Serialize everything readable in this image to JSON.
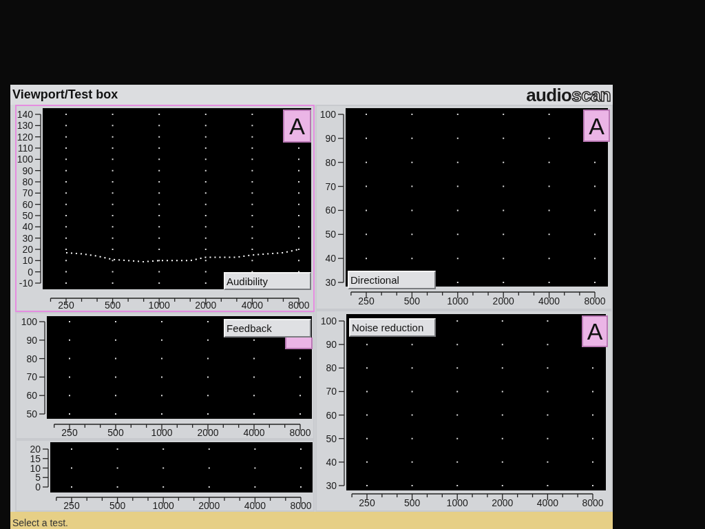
{
  "window": {
    "title": "Viewport/Test box",
    "logo": [
      "audio",
      "scan"
    ]
  },
  "panels": [
    {
      "selected": true,
      "badge": "A",
      "button": "Audibility",
      "chart_data": {
        "type": "line",
        "grid": true,
        "categories": [
          "250",
          null,
          null,
          "500",
          null,
          null,
          "1000",
          null,
          null,
          "2000",
          null,
          null,
          "4000",
          null,
          null,
          "8000"
        ],
        "ylim": [
          -10,
          140
        ],
        "yticks": [
          -10,
          0,
          10,
          20,
          30,
          40,
          50,
          60,
          70,
          80,
          90,
          100,
          110,
          120,
          130,
          140
        ],
        "series": [
          {
            "color": "#ffffff",
            "line_style": "dotted",
            "values": [
              17,
              16,
              14,
              11,
              10,
              9,
              10,
              10,
              10,
              13,
              13,
              13,
              15,
              16,
              17,
              20
            ]
          }
        ]
      }
    },
    {
      "selected": false,
      "badge": "A",
      "button": "Directional",
      "chart_data": {
        "type": "line",
        "grid": true,
        "categories": [
          "250",
          null,
          null,
          "500",
          null,
          null,
          "1000",
          null,
          null,
          "2000",
          null,
          null,
          "4000",
          null,
          null,
          "8000"
        ],
        "ylim": [
          30,
          100
        ],
        "yticks": [
          30,
          40,
          50,
          60,
          70,
          80,
          90,
          100
        ]
      }
    },
    {
      "selected": false,
      "badge_covered": true,
      "button": "Feedback",
      "chart_data": {
        "type": "line",
        "grid": true,
        "categories": [
          "250",
          null,
          null,
          "500",
          null,
          null,
          "1000",
          null,
          null,
          "2000",
          null,
          null,
          "4000",
          null,
          null,
          "8000"
        ],
        "ylim": [
          50,
          100
        ],
        "yticks": [
          50,
          60,
          70,
          80,
          90,
          100
        ]
      }
    },
    {
      "selected": false,
      "badge": "A",
      "button": "Noise reduction",
      "chart_data": {
        "type": "line",
        "grid": true,
        "categories": [
          "250",
          null,
          null,
          "500",
          null,
          null,
          "1000",
          null,
          null,
          "2000",
          null,
          null,
          "4000",
          null,
          null,
          "8000"
        ],
        "ylim": [
          30,
          100
        ],
        "yticks": [
          30,
          40,
          50,
          60,
          70,
          80,
          90,
          100
        ]
      }
    },
    {
      "selected": false,
      "chart_data": {
        "type": "line",
        "grid": true,
        "categories": [
          "250",
          null,
          null,
          "500",
          null,
          null,
          "1000",
          null,
          null,
          "2000",
          null,
          null,
          "4000",
          null,
          null,
          "8000"
        ],
        "ylim": [
          0,
          20
        ],
        "yticks": [
          0,
          5,
          10,
          15,
          20
        ]
      }
    }
  ],
  "status_bar": "Select a test."
}
